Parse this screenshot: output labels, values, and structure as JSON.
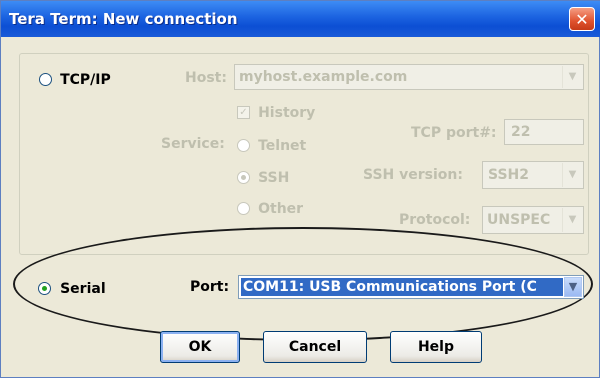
{
  "window": {
    "title": "Tera Term: New connection",
    "close_glyph": "✕"
  },
  "tcpip": {
    "radio_label": "TCP/IP",
    "host_label": "Host:",
    "host_value": "myhost.example.com",
    "history_label": "History",
    "service_label": "Service:",
    "services": [
      "Telnet",
      "SSH",
      "Other"
    ],
    "tcp_port_label": "TCP port#:",
    "tcp_port_value": "22",
    "ssh_version_label": "SSH version:",
    "ssh_version_value": "SSH2",
    "protocol_label": "Protocol:",
    "protocol_value": "UNSPEC"
  },
  "serial": {
    "radio_label": "Serial",
    "port_label": "Port:",
    "port_value": "COM11: USB Communications Port (C"
  },
  "buttons": {
    "ok": "OK",
    "cancel": "Cancel",
    "help": "Help"
  },
  "icons": {
    "dropdown": "chevron-down-icon",
    "close": "close-icon"
  },
  "colors": {
    "title_bar": "#1b62e0",
    "selection": "#316ac5",
    "dialog_bg": "#ece9d8"
  }
}
